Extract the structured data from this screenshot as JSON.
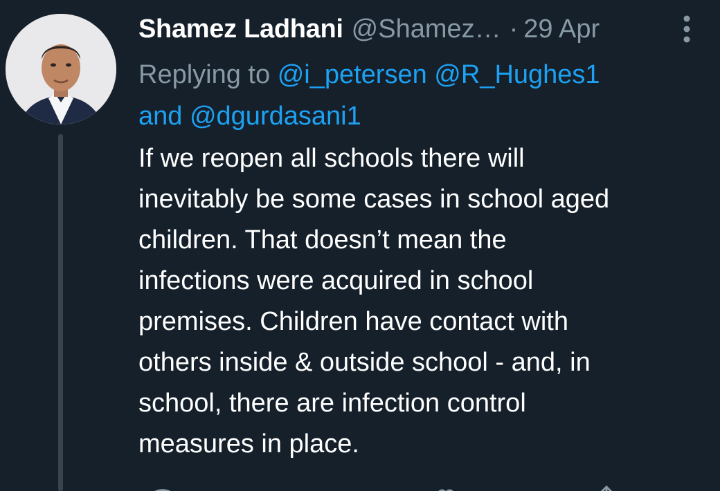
{
  "tweet": {
    "display_name": "Shamez Ladhani",
    "handle": "@Shamez…",
    "separator": "·",
    "timestamp": "29 Apr",
    "reply_prefix": "Replying to",
    "mentions": [
      "@i_petersen",
      "@R_Hughes1",
      "@dgurdasani1"
    ],
    "mention_joiner": "and",
    "text": "If we reopen all schools there will\ninevitably be some cases in school aged\nchildren. That doesn’t mean the\ninfections were acquired in school\npremises. Children have contact with\nothers inside & outside school - and, in\nschool, there are infection control\nmeasures in place."
  },
  "icons": {
    "more": "more-vertical-icon",
    "actions": [
      "reply-icon",
      "retweet-icon",
      "like-icon",
      "share-icon"
    ]
  },
  "colors": {
    "background": "#15202b",
    "text": "#ffffff",
    "muted": "#8899a6",
    "link": "#1da1f2",
    "thread_line": "#38444d"
  }
}
